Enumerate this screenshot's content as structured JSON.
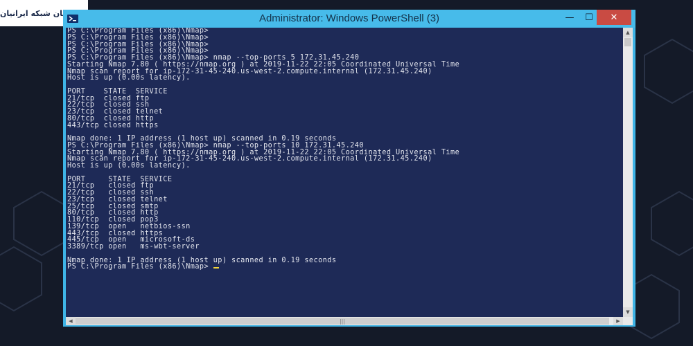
{
  "brand": {
    "name": "ماهان شبکه ایرانیان"
  },
  "window": {
    "title": "Administrator: Windows PowerShell (3)",
    "minimize_glyph": "—",
    "maximize_glyph": "☐",
    "close_glyph": "✕"
  },
  "console": {
    "lines": [
      "PS C:\\Program Files (x86)\\Nmap>",
      "PS C:\\Program Files (x86)\\Nmap>",
      "PS C:\\Program Files (x86)\\Nmap>",
      "PS C:\\Program Files (x86)\\Nmap>",
      "PS C:\\Program Files (x86)\\Nmap> nmap --top-ports 5 172.31.45.240",
      "Starting Nmap 7.80 ( https://nmap.org ) at 2019-11-22 22:05 Coordinated Universal Time",
      "Nmap scan report for ip-172-31-45-240.us-west-2.compute.internal (172.31.45.240)",
      "Host is up (0.00s latency).",
      "",
      "PORT    STATE  SERVICE",
      "21/tcp  closed ftp",
      "22/tcp  closed ssh",
      "23/tcp  closed telnet",
      "80/tcp  closed http",
      "443/tcp closed https",
      "",
      "Nmap done: 1 IP address (1 host up) scanned in 0.19 seconds",
      "PS C:\\Program Files (x86)\\Nmap> nmap --top-ports 10 172.31.45.240",
      "Starting Nmap 7.80 ( https://nmap.org ) at 2019-11-22 22:05 Coordinated Universal Time",
      "Nmap scan report for ip-172-31-45-240.us-west-2.compute.internal (172.31.45.240)",
      "Host is up (0.00s latency).",
      "",
      "PORT     STATE  SERVICE",
      "21/tcp   closed ftp",
      "22/tcp   closed ssh",
      "23/tcp   closed telnet",
      "25/tcp   closed smtp",
      "80/tcp   closed http",
      "110/tcp  closed pop3",
      "139/tcp  open   netbios-ssn",
      "443/tcp  closed https",
      "445/tcp  open   microsoft-ds",
      "3389/tcp open   ms-wbt-server",
      "",
      "Nmap done: 1 IP address (1 host up) scanned in 0.19 seconds"
    ],
    "prompt": "PS C:\\Program Files (x86)\\Nmap> "
  },
  "colors": {
    "console_bg": "#1e2a57",
    "console_text": "#e4e6ee",
    "titlebar": "#47bbea",
    "close_button": "#c94b43",
    "cursor": "#f1d33a"
  },
  "icons": {
    "app": "powershell-icon",
    "brand": "brand-logo-icon"
  }
}
